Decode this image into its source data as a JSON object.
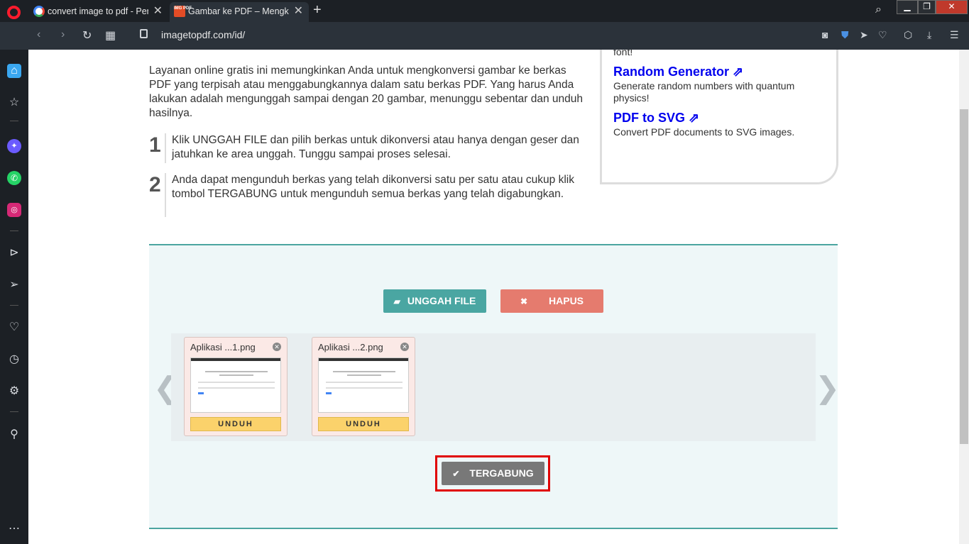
{
  "browser": {
    "tabs": [
      {
        "label": "convert image to pdf - Pen",
        "favicon": "google-icon"
      },
      {
        "label": "Gambar ke PDF – Mengkon",
        "favicon": "imgpdf-icon",
        "favicon_text": "IMG PDF",
        "active": true
      }
    ],
    "url": "imagetopdf.com/id/"
  },
  "page": {
    "ad_partial_text": "font!",
    "links": [
      {
        "title": "Random Generator ⇗",
        "desc": "Generate random numbers with quantum physics!"
      },
      {
        "title": "PDF to SVG ⇗",
        "desc": "Convert PDF documents to SVG images."
      }
    ],
    "intro": "Layanan online gratis ini memungkinkan Anda untuk mengkonversi gambar ke berkas PDF yang terpisah atau menggabungkannya dalam satu berkas PDF. Yang harus Anda lakukan adalah mengunggah sampai dengan 20 gambar, menunggu sebentar dan unduh hasilnya.",
    "steps": [
      {
        "num": "1",
        "text": "Klik UNGGAH FILE dan pilih berkas untuk dikonversi atau hanya dengan geser dan jatuhkan ke area unggah. Tunggu sampai proses selesai."
      },
      {
        "num": "2",
        "text": "Anda dapat mengunduh berkas yang telah dikonversi satu per satu atau cukup klik tombol TERGABUNG untuk mengunduh semua berkas yang telah digabungkan."
      }
    ]
  },
  "converter": {
    "upload_label": "UNGGAH FILE",
    "clear_label": "HAPUS",
    "files": [
      {
        "name": "Aplikasi ...1.png",
        "download_label": "UNDUH"
      },
      {
        "name": "Aplikasi ...2.png",
        "download_label": "UNDUH"
      }
    ],
    "merge_label": "TERGABUNG",
    "prev_arrow": "❮",
    "next_arrow": "❯"
  },
  "colors": {
    "accent": "#4aa6a2",
    "clear": "#e57b6e",
    "merge": "#787878",
    "highlight": "#e00000"
  }
}
